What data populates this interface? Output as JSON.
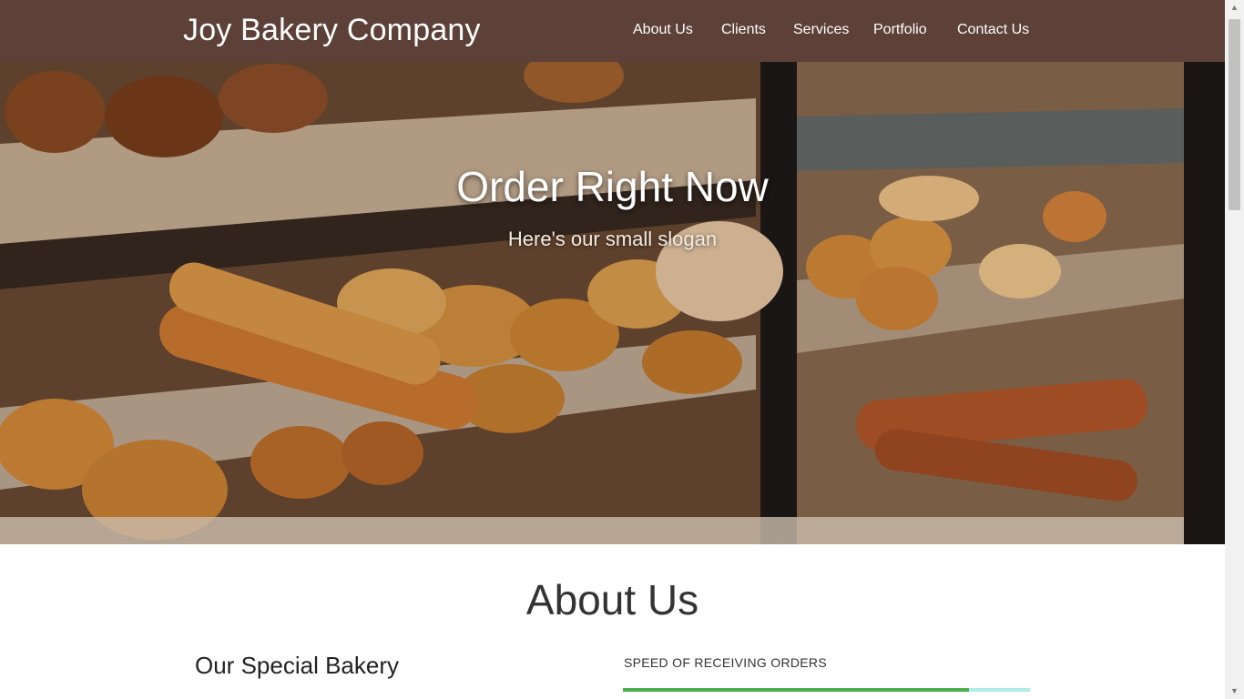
{
  "header": {
    "brand": "Joy Bakery Company",
    "nav": [
      {
        "label": "About Us"
      },
      {
        "label": "Clients"
      },
      {
        "label": "Services"
      },
      {
        "label": "Portfolio"
      },
      {
        "label": "Contact Us"
      }
    ],
    "background_color": "#5d4037"
  },
  "hero": {
    "title": "Order Right Now",
    "subtitle": "Here's our small slogan"
  },
  "about": {
    "title": "About Us",
    "subheading": "Our Special Bakery",
    "progress": {
      "label": "SPEED OF RECEIVING ORDERS",
      "percent": 85,
      "fill_color": "#4caf50",
      "track_color": "#b2ebe7"
    }
  },
  "scrollbar": {
    "up_icon": "arrow-up-icon",
    "down_icon": "arrow-down-icon"
  }
}
